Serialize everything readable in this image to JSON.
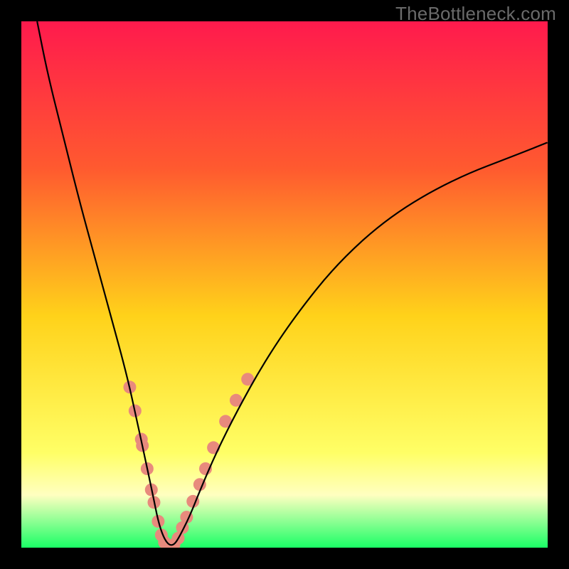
{
  "watermark": "TheBottleneck.com",
  "chart_data": {
    "type": "line",
    "title": "",
    "xlabel": "",
    "ylabel": "",
    "xlim": [
      0,
      100
    ],
    "ylim": [
      0,
      100
    ],
    "grid": false,
    "legend": false,
    "background_gradient": {
      "top_color": "#ff1a4d",
      "mid_upper_color": "#ff5a2f",
      "mid_color": "#ffd21a",
      "mid_lower_color": "#ffff66",
      "band_color": "#ffffc0",
      "bottom_color": "#1aff66"
    },
    "series": [
      {
        "name": "bottleneck-curve",
        "color": "#000000",
        "x": [
          3,
          5,
          8,
          11,
          14,
          17,
          20,
          22,
          23.5,
          25,
          26,
          27,
          28,
          29,
          30,
          32,
          34,
          37,
          41,
          46,
          52,
          60,
          70,
          82,
          95,
          100
        ],
        "y": [
          100,
          90,
          78,
          66,
          55,
          44,
          33,
          24,
          17,
          10,
          5,
          2,
          0.5,
          0.5,
          2,
          6,
          11,
          18,
          26,
          35,
          44,
          54,
          63,
          70,
          75,
          77
        ]
      }
    ],
    "markers": {
      "name": "highlight-dots",
      "color": "#e88a7d",
      "points_xy": [
        [
          20.6,
          30.5
        ],
        [
          21.6,
          26.0
        ],
        [
          22.8,
          20.6
        ],
        [
          23.0,
          19.4
        ],
        [
          23.9,
          15.0
        ],
        [
          24.7,
          11.0
        ],
        [
          25.2,
          8.6
        ],
        [
          26.0,
          5.0
        ],
        [
          26.6,
          2.4
        ],
        [
          27.2,
          1.0
        ],
        [
          27.8,
          0.4
        ],
        [
          28.4,
          0.4
        ],
        [
          29.0,
          0.6
        ],
        [
          29.8,
          1.8
        ],
        [
          30.6,
          3.8
        ],
        [
          31.4,
          5.8
        ],
        [
          32.6,
          8.8
        ],
        [
          33.9,
          12.0
        ],
        [
          35.0,
          15.0
        ],
        [
          36.5,
          19.0
        ],
        [
          38.8,
          24.0
        ],
        [
          40.8,
          28.0
        ],
        [
          43.0,
          32.0
        ]
      ]
    }
  }
}
